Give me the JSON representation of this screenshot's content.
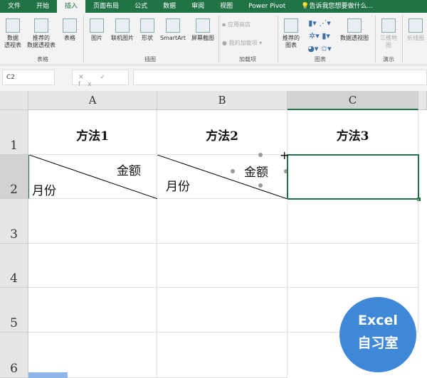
{
  "tabs": [
    "文件",
    "开始",
    "插入",
    "页面布局",
    "公式",
    "数据",
    "审阅",
    "视图",
    "Power Pivot",
    "告诉我您想要做什么..."
  ],
  "active_tab": "插入",
  "ribbon": {
    "pivot": "数据\n透视表",
    "recommended_pivot": "推荐的\n数据透视表",
    "table": "表格",
    "group_tables": "表格",
    "pictures": "图片",
    "online_pictures": "联机图片",
    "shapes": "形状",
    "smartart": "SmartArt",
    "screenshot": "屏幕截图",
    "group_illustrations": "插图",
    "store": "应用商店",
    "my_addins": "我的加载项",
    "group_addins": "加载项",
    "recommended_charts": "推荐的\n图表",
    "pivot_chart": "数据透视图",
    "group_charts": "图表",
    "map3d": "三维地\n图",
    "group_tours": "演示",
    "sparkline": "折线图"
  },
  "namebox": "C2",
  "fx_buttons": "✕ ✓ fx",
  "columns": [
    "A",
    "B",
    "C"
  ],
  "rows": [
    "1",
    "2",
    "3",
    "4",
    "5",
    "6"
  ],
  "cells": {
    "A1": "方法1",
    "B1": "方法2",
    "C1": "方法3",
    "A2_top": "金额",
    "A2_bottom": "月份",
    "B2_top": "金额",
    "B2_bottom": "月份"
  },
  "selected_cell": "C2",
  "watermark": {
    "line1": "Excel",
    "line2": "自习室",
    "color": "#3f88d8"
  }
}
